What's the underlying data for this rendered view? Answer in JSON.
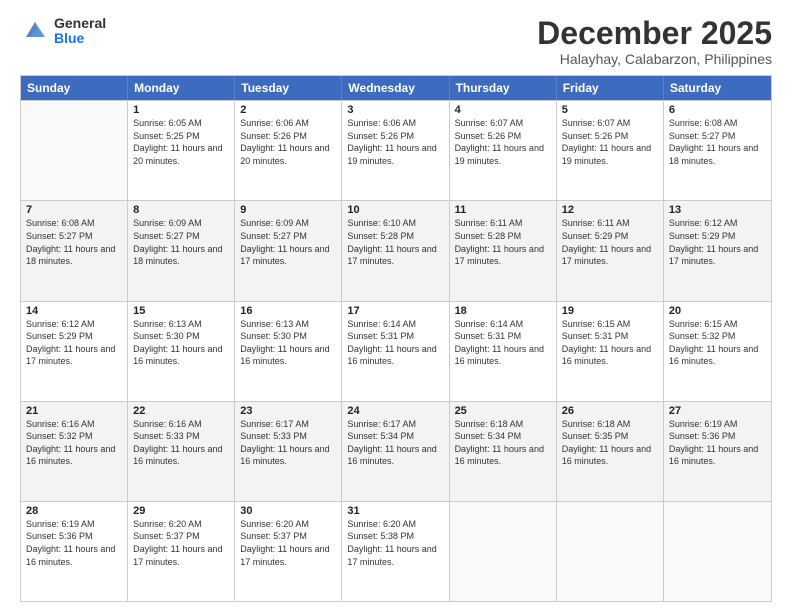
{
  "logo": {
    "general": "General",
    "blue": "Blue"
  },
  "title": "December 2025",
  "subtitle": "Halayhay, Calabarzon, Philippines",
  "weekdays": [
    "Sunday",
    "Monday",
    "Tuesday",
    "Wednesday",
    "Thursday",
    "Friday",
    "Saturday"
  ],
  "rows": [
    [
      {
        "day": "",
        "sunrise": "",
        "sunset": "",
        "daylight": "",
        "empty": true
      },
      {
        "day": "1",
        "sunrise": "Sunrise: 6:05 AM",
        "sunset": "Sunset: 5:25 PM",
        "daylight": "Daylight: 11 hours and 20 minutes."
      },
      {
        "day": "2",
        "sunrise": "Sunrise: 6:06 AM",
        "sunset": "Sunset: 5:26 PM",
        "daylight": "Daylight: 11 hours and 20 minutes."
      },
      {
        "day": "3",
        "sunrise": "Sunrise: 6:06 AM",
        "sunset": "Sunset: 5:26 PM",
        "daylight": "Daylight: 11 hours and 19 minutes."
      },
      {
        "day": "4",
        "sunrise": "Sunrise: 6:07 AM",
        "sunset": "Sunset: 5:26 PM",
        "daylight": "Daylight: 11 hours and 19 minutes."
      },
      {
        "day": "5",
        "sunrise": "Sunrise: 6:07 AM",
        "sunset": "Sunset: 5:26 PM",
        "daylight": "Daylight: 11 hours and 19 minutes."
      },
      {
        "day": "6",
        "sunrise": "Sunrise: 6:08 AM",
        "sunset": "Sunset: 5:27 PM",
        "daylight": "Daylight: 11 hours and 18 minutes."
      }
    ],
    [
      {
        "day": "7",
        "sunrise": "Sunrise: 6:08 AM",
        "sunset": "Sunset: 5:27 PM",
        "daylight": "Daylight: 11 hours and 18 minutes."
      },
      {
        "day": "8",
        "sunrise": "Sunrise: 6:09 AM",
        "sunset": "Sunset: 5:27 PM",
        "daylight": "Daylight: 11 hours and 18 minutes."
      },
      {
        "day": "9",
        "sunrise": "Sunrise: 6:09 AM",
        "sunset": "Sunset: 5:27 PM",
        "daylight": "Daylight: 11 hours and 17 minutes."
      },
      {
        "day": "10",
        "sunrise": "Sunrise: 6:10 AM",
        "sunset": "Sunset: 5:28 PM",
        "daylight": "Daylight: 11 hours and 17 minutes."
      },
      {
        "day": "11",
        "sunrise": "Sunrise: 6:11 AM",
        "sunset": "Sunset: 5:28 PM",
        "daylight": "Daylight: 11 hours and 17 minutes."
      },
      {
        "day": "12",
        "sunrise": "Sunrise: 6:11 AM",
        "sunset": "Sunset: 5:29 PM",
        "daylight": "Daylight: 11 hours and 17 minutes."
      },
      {
        "day": "13",
        "sunrise": "Sunrise: 6:12 AM",
        "sunset": "Sunset: 5:29 PM",
        "daylight": "Daylight: 11 hours and 17 minutes."
      }
    ],
    [
      {
        "day": "14",
        "sunrise": "Sunrise: 6:12 AM",
        "sunset": "Sunset: 5:29 PM",
        "daylight": "Daylight: 11 hours and 17 minutes."
      },
      {
        "day": "15",
        "sunrise": "Sunrise: 6:13 AM",
        "sunset": "Sunset: 5:30 PM",
        "daylight": "Daylight: 11 hours and 16 minutes."
      },
      {
        "day": "16",
        "sunrise": "Sunrise: 6:13 AM",
        "sunset": "Sunset: 5:30 PM",
        "daylight": "Daylight: 11 hours and 16 minutes."
      },
      {
        "day": "17",
        "sunrise": "Sunrise: 6:14 AM",
        "sunset": "Sunset: 5:31 PM",
        "daylight": "Daylight: 11 hours and 16 minutes."
      },
      {
        "day": "18",
        "sunrise": "Sunrise: 6:14 AM",
        "sunset": "Sunset: 5:31 PM",
        "daylight": "Daylight: 11 hours and 16 minutes."
      },
      {
        "day": "19",
        "sunrise": "Sunrise: 6:15 AM",
        "sunset": "Sunset: 5:31 PM",
        "daylight": "Daylight: 11 hours and 16 minutes."
      },
      {
        "day": "20",
        "sunrise": "Sunrise: 6:15 AM",
        "sunset": "Sunset: 5:32 PM",
        "daylight": "Daylight: 11 hours and 16 minutes."
      }
    ],
    [
      {
        "day": "21",
        "sunrise": "Sunrise: 6:16 AM",
        "sunset": "Sunset: 5:32 PM",
        "daylight": "Daylight: 11 hours and 16 minutes."
      },
      {
        "day": "22",
        "sunrise": "Sunrise: 6:16 AM",
        "sunset": "Sunset: 5:33 PM",
        "daylight": "Daylight: 11 hours and 16 minutes."
      },
      {
        "day": "23",
        "sunrise": "Sunrise: 6:17 AM",
        "sunset": "Sunset: 5:33 PM",
        "daylight": "Daylight: 11 hours and 16 minutes."
      },
      {
        "day": "24",
        "sunrise": "Sunrise: 6:17 AM",
        "sunset": "Sunset: 5:34 PM",
        "daylight": "Daylight: 11 hours and 16 minutes."
      },
      {
        "day": "25",
        "sunrise": "Sunrise: 6:18 AM",
        "sunset": "Sunset: 5:34 PM",
        "daylight": "Daylight: 11 hours and 16 minutes."
      },
      {
        "day": "26",
        "sunrise": "Sunrise: 6:18 AM",
        "sunset": "Sunset: 5:35 PM",
        "daylight": "Daylight: 11 hours and 16 minutes."
      },
      {
        "day": "27",
        "sunrise": "Sunrise: 6:19 AM",
        "sunset": "Sunset: 5:36 PM",
        "daylight": "Daylight: 11 hours and 16 minutes."
      }
    ],
    [
      {
        "day": "28",
        "sunrise": "Sunrise: 6:19 AM",
        "sunset": "Sunset: 5:36 PM",
        "daylight": "Daylight: 11 hours and 16 minutes."
      },
      {
        "day": "29",
        "sunrise": "Sunrise: 6:20 AM",
        "sunset": "Sunset: 5:37 PM",
        "daylight": "Daylight: 11 hours and 17 minutes."
      },
      {
        "day": "30",
        "sunrise": "Sunrise: 6:20 AM",
        "sunset": "Sunset: 5:37 PM",
        "daylight": "Daylight: 11 hours and 17 minutes."
      },
      {
        "day": "31",
        "sunrise": "Sunrise: 6:20 AM",
        "sunset": "Sunset: 5:38 PM",
        "daylight": "Daylight: 11 hours and 17 minutes."
      },
      {
        "day": "",
        "sunrise": "",
        "sunset": "",
        "daylight": "",
        "empty": true
      },
      {
        "day": "",
        "sunrise": "",
        "sunset": "",
        "daylight": "",
        "empty": true
      },
      {
        "day": "",
        "sunrise": "",
        "sunset": "",
        "daylight": "",
        "empty": true
      }
    ]
  ]
}
